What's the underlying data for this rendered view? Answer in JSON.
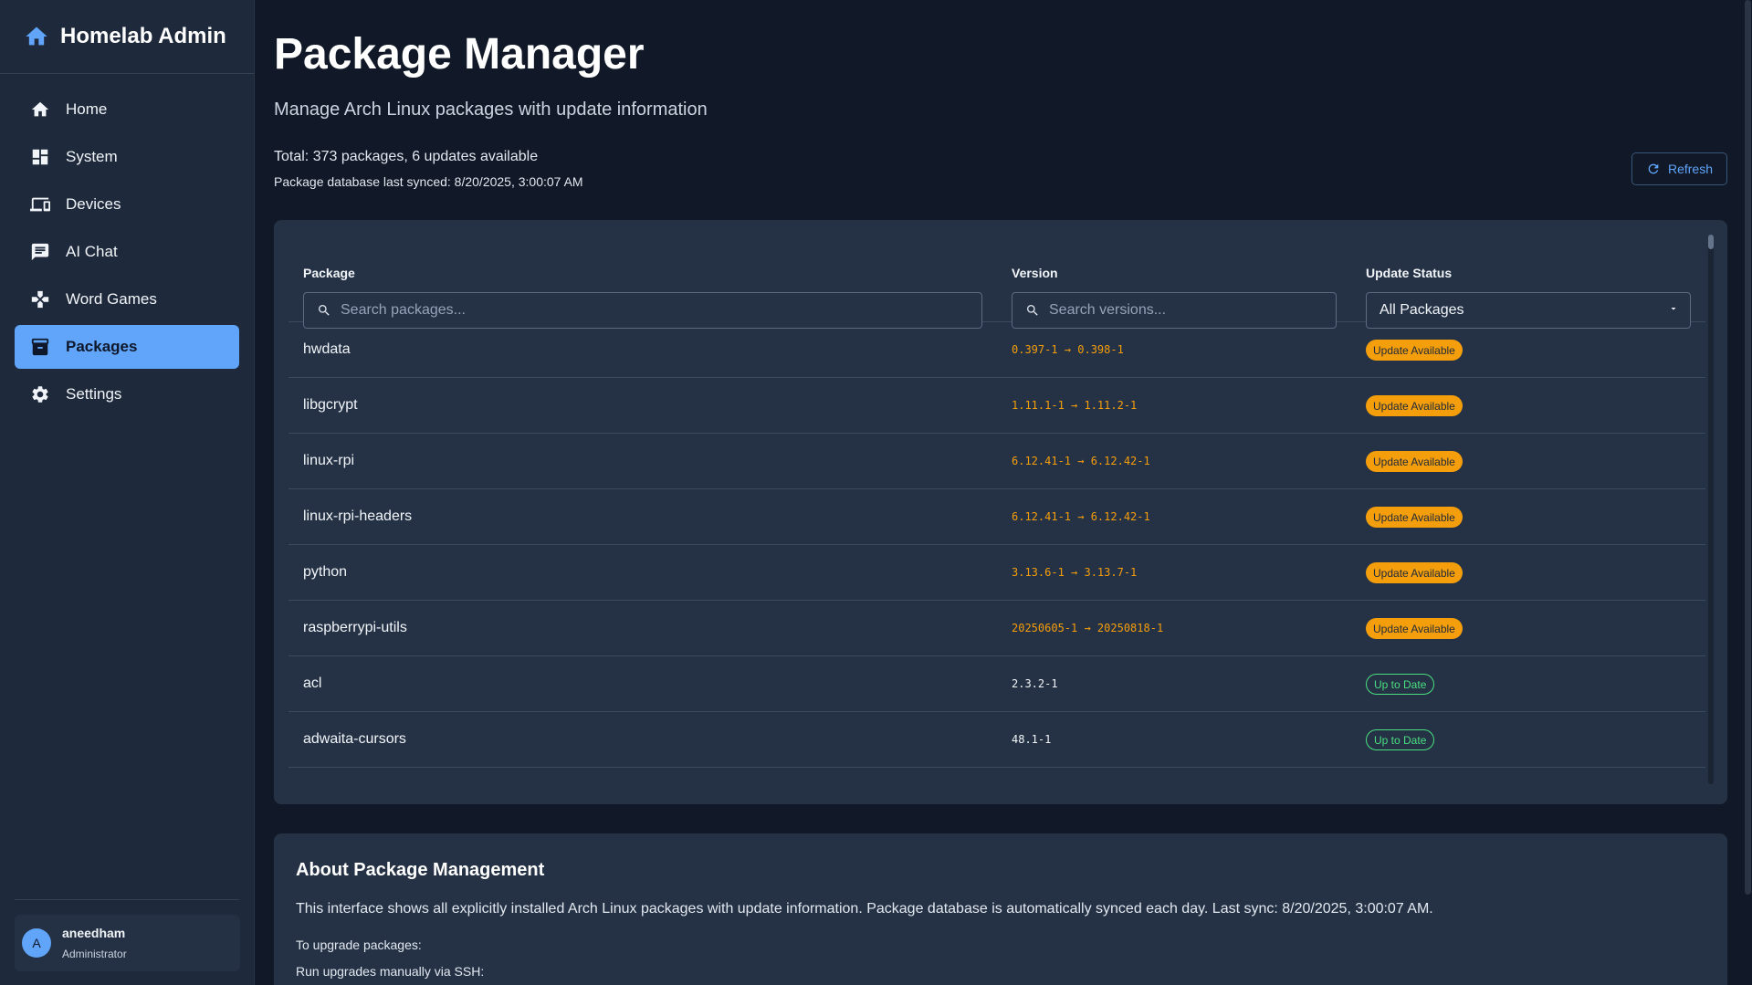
{
  "sidebar": {
    "brand": "Homelab Admin",
    "items": [
      {
        "label": "Home",
        "icon": "home-icon"
      },
      {
        "label": "System",
        "icon": "dashboard-icon"
      },
      {
        "label": "Devices",
        "icon": "devices-icon"
      },
      {
        "label": "AI Chat",
        "icon": "chat-icon"
      },
      {
        "label": "Word Games",
        "icon": "gamepad-icon"
      },
      {
        "label": "Packages",
        "icon": "archive-icon",
        "active": true
      },
      {
        "label": "Settings",
        "icon": "gear-icon"
      }
    ],
    "user": {
      "initial": "A",
      "name": "aneedham",
      "role": "Administrator"
    }
  },
  "header": {
    "title": "Package Manager",
    "subtitle": "Manage Arch Linux packages with update information",
    "stats": "Total: 373 packages, 6 updates available",
    "synced": "Package database last synced: 8/20/2025, 3:00:07 AM",
    "refresh_label": "Refresh"
  },
  "table": {
    "columns": {
      "package": "Package",
      "version": "Version",
      "status": "Update Status"
    },
    "package_placeholder": "Search packages...",
    "version_placeholder": "Search versions...",
    "status_filter": "All Packages",
    "rows": [
      {
        "name": "hwdata",
        "version": "0.397-1 → 0.398-1",
        "status": "Update Available",
        "update": true
      },
      {
        "name": "libgcrypt",
        "version": "1.11.1-1 → 1.11.2-1",
        "status": "Update Available",
        "update": true
      },
      {
        "name": "linux-rpi",
        "version": "6.12.41-1 → 6.12.42-1",
        "status": "Update Available",
        "update": true
      },
      {
        "name": "linux-rpi-headers",
        "version": "6.12.41-1 → 6.12.42-1",
        "status": "Update Available",
        "update": true
      },
      {
        "name": "python",
        "version": "3.13.6-1 → 3.13.7-1",
        "status": "Update Available",
        "update": true
      },
      {
        "name": "raspberrypi-utils",
        "version": "20250605-1 → 20250818-1",
        "status": "Update Available",
        "update": true
      },
      {
        "name": "acl",
        "version": "2.3.2-1",
        "status": "Up to Date",
        "update": false
      },
      {
        "name": "adwaita-cursors",
        "version": "48.1-1",
        "status": "Up to Date",
        "update": false
      }
    ]
  },
  "about": {
    "title": "About Package Management",
    "description": "This interface shows all explicitly installed Arch Linux packages with update information. Package database is automatically synced each day. Last sync: 8/20/2025, 3:00:07 AM.",
    "upgrade_label": "To upgrade packages:",
    "ssh_label": "Run upgrades manually via SSH:"
  },
  "colors": {
    "accent": "#60a5fa",
    "update_badge": "#f59e0b",
    "update_text": "#f59e0b",
    "ok_badge": "#4ade80"
  }
}
